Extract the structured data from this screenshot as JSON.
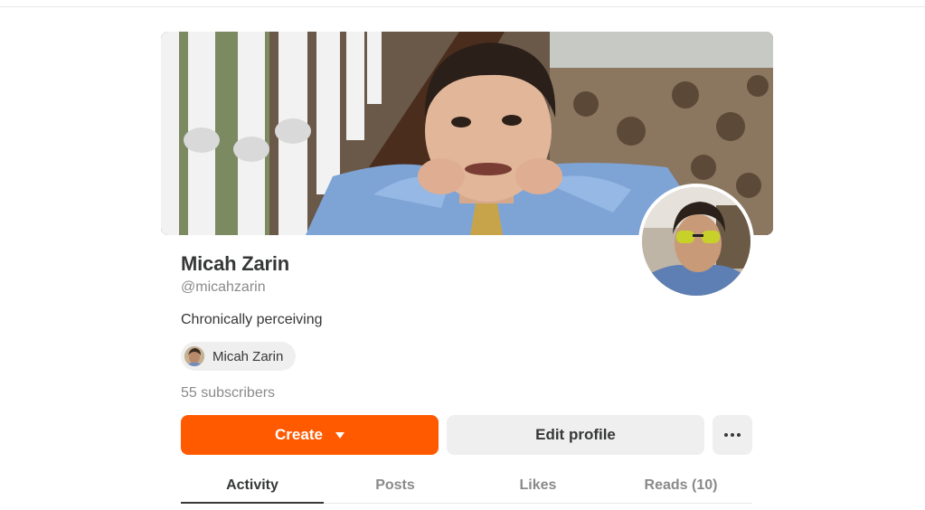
{
  "profile": {
    "name": "Micah Zarin",
    "handle": "@micahzarin",
    "bio": "Chronically perceiving",
    "chip_label": "Micah Zarin",
    "subscribers": "55 subscribers"
  },
  "actions": {
    "create_label": "Create",
    "edit_label": "Edit profile",
    "more_icon": "ellipsis-icon"
  },
  "tabs": [
    {
      "label": "Activity",
      "active": true
    },
    {
      "label": "Posts",
      "active": false
    },
    {
      "label": "Likes",
      "active": false
    },
    {
      "label": "Reads (10)",
      "active": false
    }
  ],
  "colors": {
    "accent": "#ff5a00",
    "text": "#363737",
    "muted": "#8a8a8a",
    "button_bg": "#efefef"
  }
}
